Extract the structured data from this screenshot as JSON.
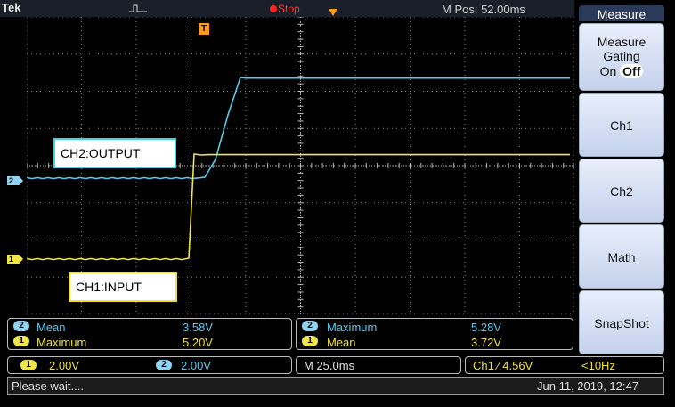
{
  "topbar": {
    "brand": "Tek",
    "run_status": "Stop",
    "position": "M Pos: 52.00ms"
  },
  "colors": {
    "ch1": "#f0e64a",
    "ch2": "#5cc8ec",
    "trigger": "#ff9a1a",
    "background": "#000000",
    "grid": "#8a8a8a"
  },
  "waveform": {
    "trigger_marker": "T",
    "ch1_marker": "1",
    "ch2_marker": "2",
    "ch2_label": "CH2:OUTPUT",
    "ch1_label": "CH1:INPUT"
  },
  "measurements": {
    "left": [
      {
        "channel": "2",
        "name": "Mean",
        "value": "3.58V"
      },
      {
        "channel": "1",
        "name": "Maximum",
        "value": "5.20V"
      }
    ],
    "right": [
      {
        "channel": "2",
        "name": "Maximum",
        "value": "5.28V"
      },
      {
        "channel": "1",
        "name": "Mean",
        "value": "3.72V"
      }
    ]
  },
  "status": {
    "ch1_badge": "1",
    "ch1_scale": "2.00V",
    "ch2_badge": "2",
    "ch2_scale": "2.00V",
    "timebase": "M 25.0ms",
    "trigger": "Ch1 ⁄ 4.56V",
    "frequency": "<10Hz"
  },
  "bottombar": {
    "message": "Please wait....",
    "datetime": "Jun 11, 2019, 12:47"
  },
  "menu": {
    "title": "Measure",
    "gating_line1": "Measure",
    "gating_line2": "Gating",
    "gating_on": "On",
    "gating_off": "Off",
    "ch1": "Ch1",
    "ch2": "Ch2",
    "math": "Math",
    "snapshot": "SnapShot"
  }
}
